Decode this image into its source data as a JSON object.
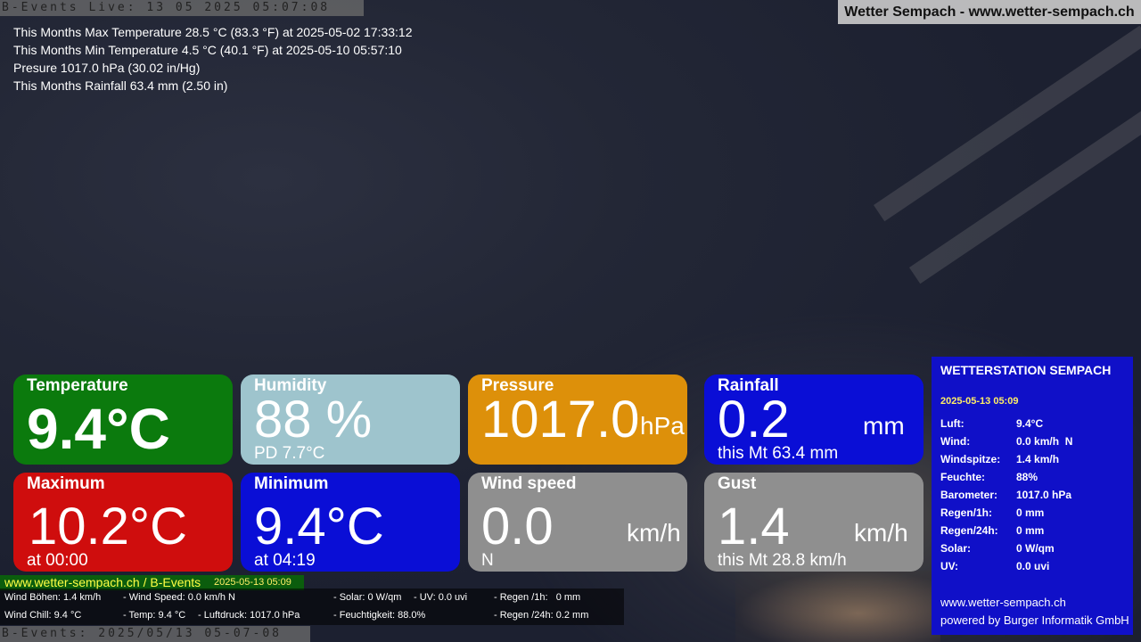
{
  "camera": {
    "timestamp_top": "B-Events Live: 13 05 2025 05:07:08",
    "timestamp_bottom": "B-Events: 2025/05/13 05-07-08"
  },
  "site_title": "Wetter Sempach - www.wetter-sempach.ch",
  "monthly_stats": [
    "This Months Max Temperature 28.5 °C (83.3 °F) at 2025-05-02 17:33:12",
    "This Months Min Temperature 4.5 °C (40.1 °F) at 2025-05-10 05:57:10",
    "Presure 1017.0 hPa (30.02 in/Hg)",
    "This Months Rainfall 63.4 mm (2.50 in)"
  ],
  "tiles": {
    "temperature": {
      "label": "Temperature",
      "value": "9.4°C"
    },
    "humidity": {
      "label": "Humidity",
      "value": "88 %",
      "sub": "PD 7.7°C"
    },
    "pressure": {
      "label": "Pressure",
      "value": "1017.0",
      "unit": "hPa"
    },
    "rainfall": {
      "label": "Rainfall",
      "value": "0.2",
      "unit": "mm",
      "sub": "this Mt 63.4 mm"
    },
    "maximum": {
      "label": "Maximum",
      "value": "10.2°C",
      "sub": "at 00:00"
    },
    "minimum": {
      "label": "Minimum",
      "value": "9.4°C",
      "sub": "at 04:19"
    },
    "wind_speed": {
      "label": "Wind speed",
      "value": "0.0",
      "unit": "km/h",
      "sub": "N"
    },
    "gust": {
      "label": "Gust",
      "value": "1.4",
      "unit": "km/h",
      "sub": "this Mt 28.8 km/h"
    }
  },
  "station": {
    "title": "WETTERSTATION SEMPACH",
    "date": "2025-05-13 05:09",
    "rows": [
      {
        "k": "Luft:",
        "v": "9.4°C"
      },
      {
        "k": "Wind:",
        "v": "0.0 km/h  N"
      },
      {
        "k": "Windspitze:",
        "v": "1.4 km/h"
      },
      {
        "k": "Feuchte:",
        "v": "88%"
      },
      {
        "k": "Barometer:",
        "v": "1017.0 hPa"
      },
      {
        "k": "Regen/1h:",
        "v": "0 mm"
      },
      {
        "k": "Regen/24h:",
        "v": "0 mm"
      },
      {
        "k": "Solar:",
        "v": "0 W/qm"
      },
      {
        "k": "UV:",
        "v": "0.0 uvi"
      }
    ],
    "footer_url": "www.wetter-sempach.ch",
    "footer_powered": "powered by Burger Informatik GmbH"
  },
  "site_strip": {
    "url": "www.wetter-sempach.ch / B-Events",
    "date": "2025-05-13 05:09"
  },
  "bottom_bar": {
    "wind_boehen": "Wind Böhen: 1.4 km/h",
    "wind_speed": "- Wind Speed: 0.0 km/h N",
    "solar": "- Solar: 0 W/qm",
    "uv": "- UV: 0.0 uvi",
    "regen_1h": "- Regen /1h:   0 mm",
    "wind_chill": "Wind Chill: 9.4 °C",
    "temp": "- Temp: 9.4 °C",
    "luftdruck": "- Luftdruck: 1017.0 hPa",
    "feuchtigkeit": "- Feuchtigkeit: 88.0%",
    "regen_24h": "- Regen /24h: 0.2 mm"
  }
}
